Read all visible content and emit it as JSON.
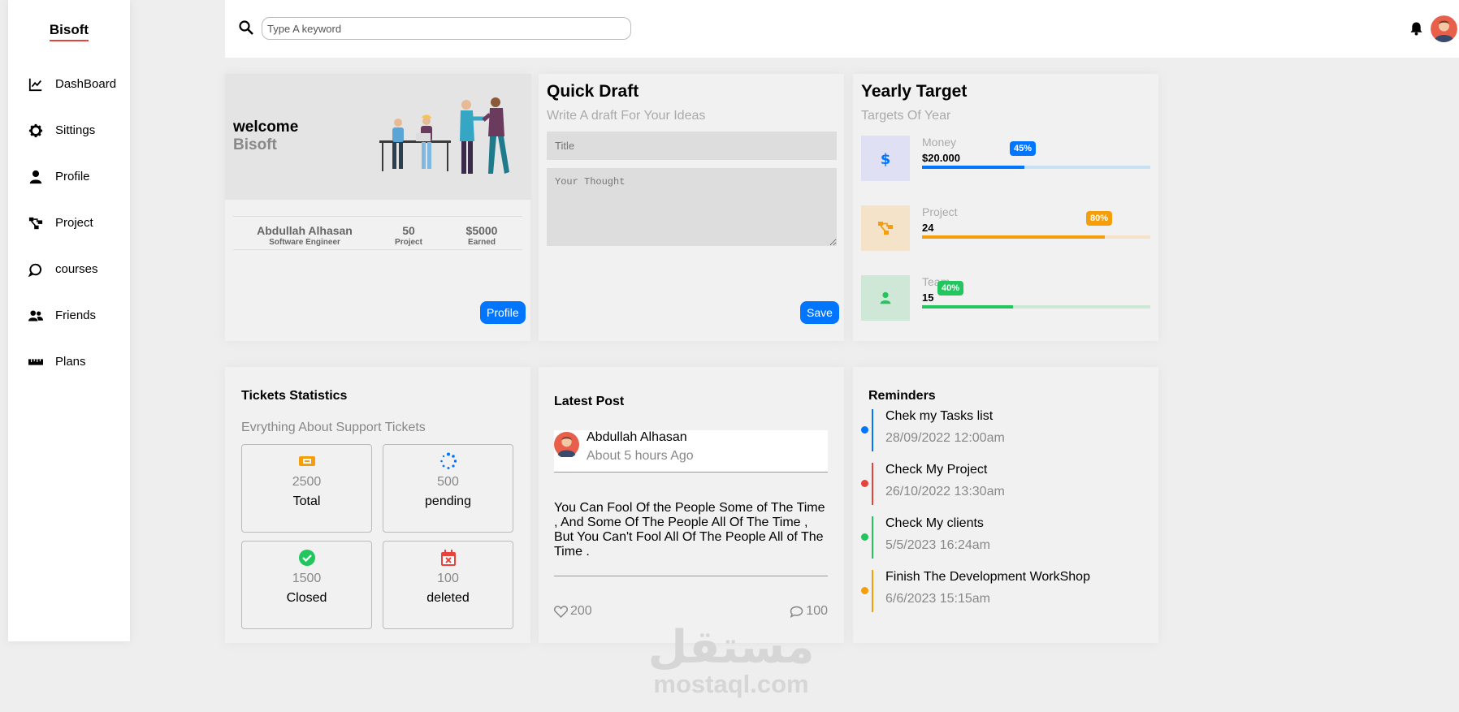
{
  "sidebar": {
    "brand": "Bisoft",
    "items": [
      {
        "label": "DashBoard",
        "icon": "chart-line-icon"
      },
      {
        "label": "Sittings",
        "icon": "gear-icon"
      },
      {
        "label": "Profile",
        "icon": "user-icon"
      },
      {
        "label": "Project",
        "icon": "diagram-project-icon"
      },
      {
        "label": "courses",
        "icon": "chat-bubble-icon"
      },
      {
        "label": "Friends",
        "icon": "users-icon"
      },
      {
        "label": "Plans",
        "icon": "ruler-icon"
      }
    ]
  },
  "header": {
    "search_placeholder": "Type A keyword"
  },
  "welcome": {
    "line1": "welcome",
    "line2": "Bisoft",
    "name": "Abdullah Alhasan",
    "role": "Software Engineer",
    "projects_value": "50",
    "projects_label": "Project",
    "earned_value": "$5000",
    "earned_label": "Earned",
    "button": "Profile"
  },
  "draft": {
    "title": "Quick Draft",
    "subtitle": "Write A draft For Your Ideas",
    "title_placeholder": "Title",
    "thought_placeholder": "Your Thought",
    "button": "Save"
  },
  "target": {
    "title": "Yearly Target",
    "subtitle": "Targets Of Year",
    "rows": [
      {
        "label": "Money",
        "value": "$20.000",
        "percent": "45%",
        "progress": 0.45,
        "icon": "dollar-icon",
        "color": "#0075ff",
        "bg": "#dfe0f4",
        "track": "#c6e1f4"
      },
      {
        "label": "Project",
        "value": "24",
        "percent": "80%",
        "progress": 0.8,
        "icon": "diagram-project-icon",
        "color": "#f59e0b",
        "bg": "#f5e3c9",
        "track": "#f6e2c8"
      },
      {
        "label": "Team",
        "value": "15",
        "percent": "40%",
        "progress": 0.4,
        "icon": "user-icon",
        "color": "#22c55e",
        "bg": "#cfe7d6",
        "track": "#cde7d5"
      }
    ]
  },
  "tickets": {
    "title": "Tickets Statistics",
    "subtitle": "Evrything About Support Tickets",
    "boxes": [
      {
        "value": "2500",
        "label": "Total",
        "icon": "ticket-icon",
        "color": "#f59e0b"
      },
      {
        "value": "500",
        "label": "pending",
        "icon": "spinner-icon",
        "color": "#0075ff"
      },
      {
        "value": "1500",
        "label": "Closed",
        "icon": "check-circle-icon",
        "color": "#22c55e"
      },
      {
        "value": "100",
        "label": "deleted",
        "icon": "calendar-x-icon",
        "color": "#e8433a"
      }
    ]
  },
  "post": {
    "title": "Latest Post",
    "author": "Abdullah Alhasan",
    "time": "About 5 hours Ago",
    "body": "You Can Fool Of the People Some of The Time , And Some Of The People All Of The Time , But You Can't Fool All Of The People All of The Time .",
    "likes": "200",
    "comments": "100"
  },
  "reminders": {
    "title": "Reminders",
    "items": [
      {
        "text": "Chek my Tasks list",
        "date": "28/09/2022 12:00am",
        "color": "#0075ff"
      },
      {
        "text": "Check My Project",
        "date": "26/10/2022 13:30am",
        "color": "#e8433a"
      },
      {
        "text": "Check My clients",
        "date": "5/5/2023 16:24am",
        "color": "#22c55e"
      },
      {
        "text": "Finish The Development WorkShop",
        "date": "6/6/2023 15:15am",
        "color": "#f59e0b"
      }
    ]
  },
  "watermark": {
    "arabic": "مستقل",
    "latin": "mostaql.com"
  }
}
